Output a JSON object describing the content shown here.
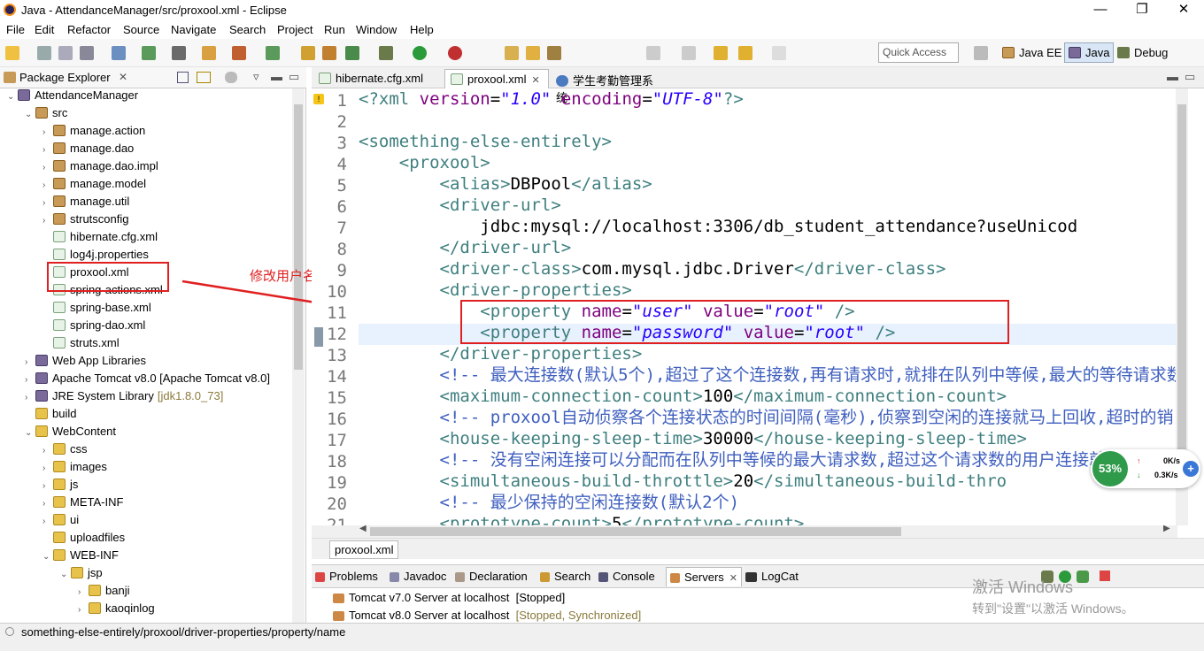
{
  "window": {
    "title": "Java - AttendanceManager/src/proxool.xml - Eclipse",
    "minimize": "—",
    "maximize": "❐",
    "close": "✕"
  },
  "menu": [
    "File",
    "Edit",
    "Refactor",
    "Source",
    "Navigate",
    "Search",
    "Project",
    "Run",
    "Window",
    "Help"
  ],
  "toolbar": {
    "quick_access_placeholder": "Quick Access",
    "perspectives": [
      "Java EE",
      "Java",
      "Debug"
    ]
  },
  "package_explorer": {
    "title": "Package Explorer",
    "items": [
      {
        "label": "AttendanceManager",
        "depth": 0,
        "twisty": "⌄",
        "icon": "project-icon"
      },
      {
        "label": "src",
        "depth": 1,
        "twisty": "⌄",
        "icon": "src-folder-icon"
      },
      {
        "label": "manage.action",
        "depth": 2,
        "twisty": "›",
        "icon": "package-icon"
      },
      {
        "label": "manage.dao",
        "depth": 2,
        "twisty": "›",
        "icon": "package-icon"
      },
      {
        "label": "manage.dao.impl",
        "depth": 2,
        "twisty": "›",
        "icon": "package-icon"
      },
      {
        "label": "manage.model",
        "depth": 2,
        "twisty": "›",
        "icon": "package-icon"
      },
      {
        "label": "manage.util",
        "depth": 2,
        "twisty": "›",
        "icon": "package-icon"
      },
      {
        "label": "strutsconfig",
        "depth": 2,
        "twisty": "›",
        "icon": "package-icon"
      },
      {
        "label": "hibernate.cfg.xml",
        "depth": 2,
        "twisty": "",
        "icon": "xml-file-icon"
      },
      {
        "label": "log4j.properties",
        "depth": 2,
        "twisty": "",
        "icon": "xml-file-icon"
      },
      {
        "label": "proxool.xml",
        "depth": 2,
        "twisty": "",
        "icon": "xml-file-icon"
      },
      {
        "label": "spring-actions.xml",
        "depth": 2,
        "twisty": "",
        "icon": "xml-file-icon"
      },
      {
        "label": "spring-base.xml",
        "depth": 2,
        "twisty": "",
        "icon": "xml-file-icon"
      },
      {
        "label": "spring-dao.xml",
        "depth": 2,
        "twisty": "",
        "icon": "xml-file-icon"
      },
      {
        "label": "struts.xml",
        "depth": 2,
        "twisty": "",
        "icon": "xml-file-icon"
      },
      {
        "label": "Web App Libraries",
        "depth": 1,
        "twisty": "›",
        "icon": "library-icon"
      },
      {
        "label": "Apache Tomcat v8.0 [Apache Tomcat v8.0]",
        "depth": 1,
        "twisty": "›",
        "icon": "library-icon"
      },
      {
        "label": "JRE System Library",
        "depth": 1,
        "twisty": "›",
        "icon": "library-icon",
        "suffix": "[jdk1.8.0_73]"
      },
      {
        "label": "build",
        "depth": 1,
        "twisty": "",
        "icon": "folder-icon"
      },
      {
        "label": "WebContent",
        "depth": 1,
        "twisty": "⌄",
        "icon": "folder-icon"
      },
      {
        "label": "css",
        "depth": 2,
        "twisty": "›",
        "icon": "folder-icon"
      },
      {
        "label": "images",
        "depth": 2,
        "twisty": "›",
        "icon": "folder-icon"
      },
      {
        "label": "js",
        "depth": 2,
        "twisty": "›",
        "icon": "folder-icon"
      },
      {
        "label": "META-INF",
        "depth": 2,
        "twisty": "›",
        "icon": "folder-icon"
      },
      {
        "label": "ui",
        "depth": 2,
        "twisty": "›",
        "icon": "folder-icon"
      },
      {
        "label": "uploadfiles",
        "depth": 2,
        "twisty": "",
        "icon": "folder-icon"
      },
      {
        "label": "WEB-INF",
        "depth": 2,
        "twisty": "⌄",
        "icon": "folder-icon"
      },
      {
        "label": "jsp",
        "depth": 3,
        "twisty": "⌄",
        "icon": "folder-icon"
      },
      {
        "label": "banji",
        "depth": 4,
        "twisty": "›",
        "icon": "folder-icon"
      },
      {
        "label": "kaoqinlog",
        "depth": 4,
        "twisty": "›",
        "icon": "folder-icon"
      }
    ]
  },
  "annotation": "修改用户名和密码",
  "editor": {
    "tabs": [
      {
        "label": "hibernate.cfg.xml",
        "active": false
      },
      {
        "label": "proxool.xml",
        "active": true
      },
      {
        "label": "学生考勤管理系统",
        "active": false
      }
    ],
    "bottom_tab": "proxool.xml",
    "lines": [
      {
        "n": "1",
        "tokens": [
          [
            "tag",
            "<?xml "
          ],
          [
            "att",
            "version"
          ],
          [
            "txt",
            "="
          ],
          [
            "val",
            "\"1.0\""
          ],
          [
            "txt",
            " "
          ],
          [
            "att",
            "encoding"
          ],
          [
            "txt",
            "="
          ],
          [
            "val",
            "\"UTF-8\""
          ],
          [
            "tag",
            "?>"
          ]
        ]
      },
      {
        "n": "2",
        "tokens": []
      },
      {
        "n": "3",
        "tokens": [
          [
            "tag",
            "<something-else-entirely>"
          ]
        ]
      },
      {
        "n": "4",
        "tokens": [
          [
            "txt",
            "    "
          ],
          [
            "tag",
            "<proxool>"
          ]
        ]
      },
      {
        "n": "5",
        "tokens": [
          [
            "txt",
            "        "
          ],
          [
            "tag",
            "<alias>"
          ],
          [
            "txt",
            "DBPool"
          ],
          [
            "tag",
            "</alias>"
          ]
        ]
      },
      {
        "n": "6",
        "tokens": [
          [
            "txt",
            "        "
          ],
          [
            "tag",
            "<driver-url>"
          ]
        ]
      },
      {
        "n": "7",
        "tokens": [
          [
            "txt",
            "            jdbc:mysql://localhost:3306/db_student_attendance?useUnicod"
          ]
        ]
      },
      {
        "n": "8",
        "tokens": [
          [
            "txt",
            "        "
          ],
          [
            "tag",
            "</driver-url>"
          ]
        ]
      },
      {
        "n": "9",
        "tokens": [
          [
            "txt",
            "        "
          ],
          [
            "tag",
            "<driver-class>"
          ],
          [
            "txt",
            "com.mysql.jdbc.Driver"
          ],
          [
            "tag",
            "</driver-class>"
          ]
        ]
      },
      {
        "n": "10",
        "tokens": [
          [
            "txt",
            "        "
          ],
          [
            "tag",
            "<driver-properties>"
          ]
        ]
      },
      {
        "n": "11",
        "tokens": [
          [
            "txt",
            "            "
          ],
          [
            "tag",
            "<property "
          ],
          [
            "att",
            "name"
          ],
          [
            "txt",
            "="
          ],
          [
            "val",
            "\"user\""
          ],
          [
            "txt",
            " "
          ],
          [
            "att",
            "value"
          ],
          [
            "txt",
            "="
          ],
          [
            "val",
            "\"root\""
          ],
          [
            "txt",
            " "
          ],
          [
            "tag",
            "/>"
          ]
        ]
      },
      {
        "n": "12",
        "tokens": [
          [
            "txt",
            "            "
          ],
          [
            "tag",
            "<property "
          ],
          [
            "att",
            "name"
          ],
          [
            "txt",
            "="
          ],
          [
            "val",
            "\"password\""
          ],
          [
            "txt",
            " "
          ],
          [
            "att",
            "value"
          ],
          [
            "txt",
            "="
          ],
          [
            "val",
            "\"root\""
          ],
          [
            "txt",
            " "
          ],
          [
            "tag",
            "/>"
          ]
        ]
      },
      {
        "n": "13",
        "tokens": [
          [
            "txt",
            "        "
          ],
          [
            "tag",
            "</driver-properties>"
          ]
        ]
      },
      {
        "n": "14",
        "tokens": [
          [
            "txt",
            "        "
          ],
          [
            "cmt",
            "<!-- 最大连接数(默认5个),超过了这个连接数,再有请求时,就排在队列中等候,最大的等待请求数"
          ]
        ]
      },
      {
        "n": "15",
        "tokens": [
          [
            "txt",
            "        "
          ],
          [
            "tag",
            "<maximum-connection-count>"
          ],
          [
            "txt",
            "100"
          ],
          [
            "tag",
            "</maximum-connection-count>"
          ]
        ]
      },
      {
        "n": "16",
        "tokens": [
          [
            "txt",
            "        "
          ],
          [
            "cmt",
            "<!-- proxool自动侦察各个连接状态的时间间隔(毫秒),侦察到空闲的连接就马上回收,超时的销"
          ]
        ]
      },
      {
        "n": "17",
        "tokens": [
          [
            "txt",
            "        "
          ],
          [
            "tag",
            "<house-keeping-sleep-time>"
          ],
          [
            "txt",
            "30000"
          ],
          [
            "tag",
            "</house-keeping-sleep-time>"
          ]
        ]
      },
      {
        "n": "18",
        "tokens": [
          [
            "txt",
            "        "
          ],
          [
            "cmt",
            "<!-- 没有空闲连接可以分配而在队列中等候的最大请求数,超过这个请求数的用户连接就"
          ]
        ]
      },
      {
        "n": "19",
        "tokens": [
          [
            "txt",
            "        "
          ],
          [
            "tag",
            "<simultaneous-build-throttle>"
          ],
          [
            "txt",
            "20"
          ],
          [
            "tag",
            "</simultaneous-build-thro"
          ]
        ]
      },
      {
        "n": "20",
        "tokens": [
          [
            "txt",
            "        "
          ],
          [
            "cmt",
            "<!-- 最少保持的空闲连接数(默认2个)"
          ]
        ]
      },
      {
        "n": "21",
        "tokens": [
          [
            "txt",
            "        "
          ],
          [
            "tag",
            "<prototype-count>"
          ],
          [
            "txt",
            "5"
          ],
          [
            "tag",
            "</prototype-count>"
          ]
        ]
      }
    ]
  },
  "bottom_panel": {
    "tabs": [
      "Problems",
      "Javadoc",
      "Declaration",
      "Search",
      "Console",
      "Servers",
      "LogCat"
    ],
    "servers": [
      {
        "name": "Tomcat v7.0 Server at localhost",
        "state": "[Stopped]"
      },
      {
        "name": "Tomcat v8.0 Server at localhost",
        "state": "[Stopped, Synchronized]"
      }
    ]
  },
  "status_bar": "something-else-entirely/proxool/driver-properties/property/name",
  "net_widget": {
    "percent": "53%",
    "up": "0K/s",
    "down": "0.3K/s"
  },
  "watermark": {
    "line1": "激活 Windows",
    "line2": "转到\"设置\"以激活 Windows。"
  },
  "colors": {
    "annotation_red": "#e02020",
    "xml_tag": "#3f7f7f",
    "xml_attr": "#7f007f",
    "xml_value": "#2a00ff",
    "comment": "#3f5fbf"
  }
}
